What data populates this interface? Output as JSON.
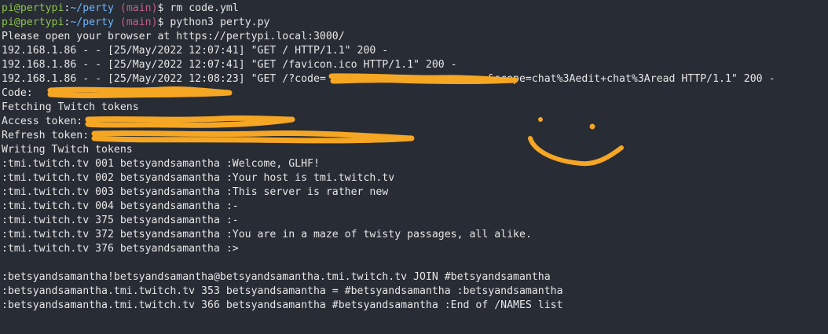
{
  "terminal": {
    "prompts": [
      {
        "user": "pi@pertypi",
        "colon": ":",
        "path": "~/perty",
        "branch": "(main)",
        "dollar": "$",
        "command": " rm code.yml"
      },
      {
        "user": "pi@pertypi",
        "colon": ":",
        "path": "~/perty",
        "branch": "(main)",
        "dollar": "$",
        "command": " python3 perty.py"
      }
    ],
    "output": [
      "Please open your browser at https://pertypi.local:3000/",
      "192.168.1.86 - - [25/May/2022 12:07:41] \"GET / HTTP/1.1\" 200 -",
      "192.168.1.86 - - [25/May/2022 12:07:41] \"GET /favicon.ico HTTP/1.1\" 200 -",
      "192.168.1.86 - - [25/May/2022 12:08:23] \"GET /?code=                          &scope=chat%3Aedit+chat%3Aread HTTP/1.1\" 200 -",
      "Code:",
      "Fetching Twitch tokens",
      "Access token:",
      "Refresh token:",
      "Writing Twitch tokens",
      ":tmi.twitch.tv 001 betsyandsamantha :Welcome, GLHF!",
      ":tmi.twitch.tv 002 betsyandsamantha :Your host is tmi.twitch.tv",
      ":tmi.twitch.tv 003 betsyandsamantha :This server is rather new",
      ":tmi.twitch.tv 004 betsyandsamantha :-",
      ":tmi.twitch.tv 375 betsyandsamantha :-",
      ":tmi.twitch.tv 372 betsyandsamantha :You are in a maze of twisty passages, all alike.",
      ":tmi.twitch.tv 376 betsyandsamantha :>",
      "",
      ":betsyandsamantha!betsyandsamantha@betsyandsamantha.tmi.twitch.tv JOIN #betsyandsamantha",
      ":betsyandsamantha.tmi.twitch.tv 353 betsyandsamantha = #betsyandsamantha :betsyandsamantha",
      ":betsyandsamantha.tmi.twitch.tv 366 betsyandsamantha #betsyandsamantha :End of /NAMES list"
    ],
    "colors": {
      "background": "#282c34",
      "text": "#e6e6e6",
      "user": "#8bc34a",
      "path": "#6cb6ff",
      "branch": "#c75f86",
      "annotation": "#f5a623"
    }
  }
}
